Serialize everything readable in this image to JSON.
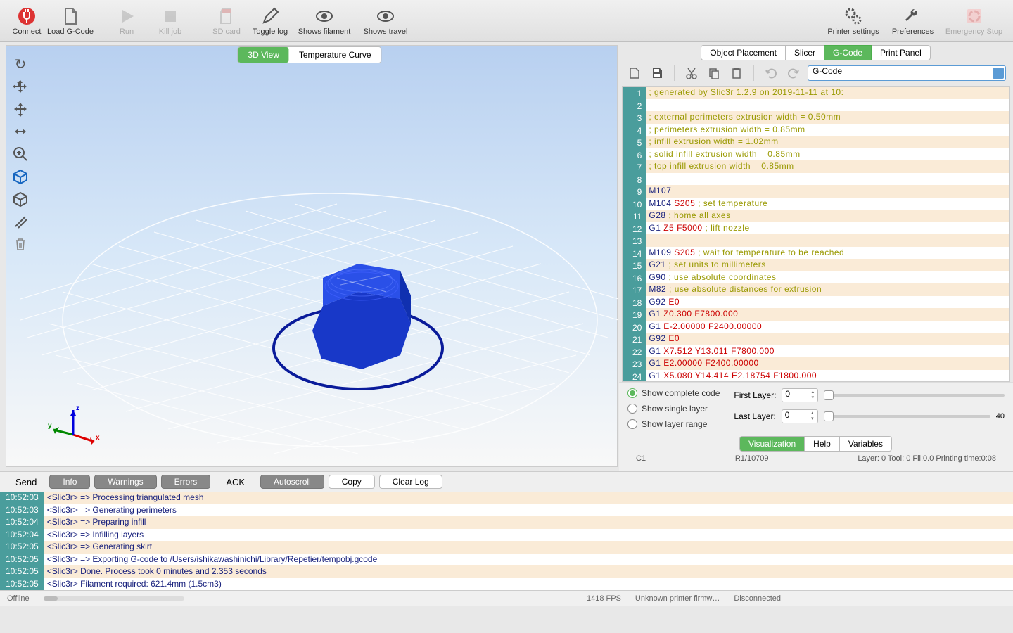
{
  "toolbar": {
    "connect": "Connect",
    "load_gcode": "Load G-Code",
    "run": "Run",
    "kill_job": "Kill job",
    "sd_card": "SD card",
    "toggle_log": "Toggle log",
    "shows_filament": "Shows filament",
    "shows_travel": "Shows travel",
    "printer_settings": "Printer settings",
    "preferences": "Preferences",
    "emergency_stop": "Emergency Stop"
  },
  "viewport_tabs": {
    "view3d": "3D View",
    "tempcurve": "Temperature Curve"
  },
  "right_tabs": {
    "placement": "Object Placement",
    "slicer": "Slicer",
    "gcode": "G-Code",
    "print_panel": "Print Panel"
  },
  "gcode_select": "G-Code",
  "gcode": {
    "lines": [
      "; generated by Slic3r 1.2.9 on 2019-11-11 at 10:",
      "",
      "; external perimeters extrusion width = 0.50mm",
      "; perimeters extrusion width = 0.85mm",
      "; infill extrusion width = 1.02mm",
      "; solid infill extrusion width = 0.85mm",
      "; top infill extrusion width = 0.85mm",
      "",
      "M107",
      "M104 S205 ; set temperature",
      "G28 ; home all axes",
      "G1 Z5 F5000 ; lift nozzle",
      "",
      "M109 S205 ; wait for temperature to be reached",
      "G21 ; set units to millimeters",
      "G90 ; use absolute coordinates",
      "M82 ; use absolute distances for extrusion",
      "G92 E0",
      "G1 Z0.300 F7800.000",
      "G1 E-2.00000 F2400.00000",
      "G92 E0",
      "G1 X7.512 Y13.011 F7800.000",
      "G1 E2.00000 F2400.00000",
      "G1 X5.080 Y14.414 E2.18754 F1800.000"
    ]
  },
  "viz": {
    "show_complete": "Show complete code",
    "show_single": "Show single layer",
    "show_range": "Show layer range",
    "first_layer": "First Layer:",
    "last_layer": "Last Layer:",
    "first_val": "0",
    "last_val": "0",
    "max": "40",
    "tabs": {
      "viz": "Visualization",
      "help": "Help",
      "vars": "Variables"
    },
    "c1": "C1",
    "r1": "R1/10709",
    "layer_info": "Layer: 0 Tool: 0 Fil:0.0 Printing time:0:08"
  },
  "console_bar": {
    "send": "Send",
    "info": "Info",
    "warnings": "Warnings",
    "errors": "Errors",
    "ack": "ACK",
    "autoscroll": "Autoscroll",
    "copy": "Copy",
    "clear": "Clear Log"
  },
  "log": [
    {
      "ts": "10:52:03",
      "msg": "<Slic3r> => Processing triangulated mesh"
    },
    {
      "ts": "10:52:03",
      "msg": "<Slic3r> => Generating perimeters"
    },
    {
      "ts": "10:52:04",
      "msg": "<Slic3r> => Preparing infill"
    },
    {
      "ts": "10:52:04",
      "msg": "<Slic3r> => Infilling layers"
    },
    {
      "ts": "10:52:05",
      "msg": "<Slic3r> => Generating skirt"
    },
    {
      "ts": "10:52:05",
      "msg": "<Slic3r> => Exporting G-code to /Users/ishikawashinichi/Library/Repetier/tempobj.gcode"
    },
    {
      "ts": "10:52:05",
      "msg": "<Slic3r> Done. Process took 0 minutes and 2.353 seconds"
    },
    {
      "ts": "10:52:05",
      "msg": "<Slic3r> Filament required: 621.4mm (1.5cm3)"
    }
  ],
  "status": {
    "offline": "Offline",
    "fps": "1418 FPS",
    "firmware": "Unknown printer firmw…",
    "conn": "Disconnected"
  }
}
